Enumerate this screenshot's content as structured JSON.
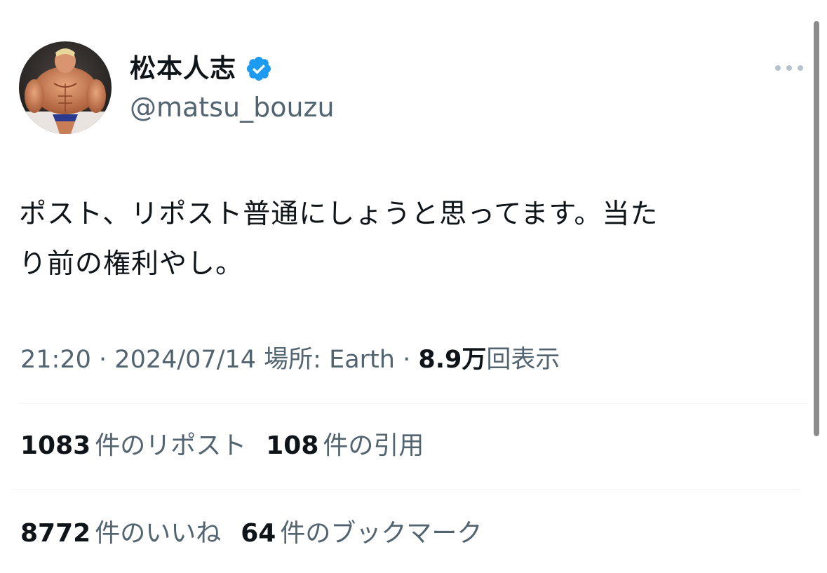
{
  "author": {
    "display_name": "松本人志",
    "handle": "@matsu_bouzu",
    "verified_badge_icon": "verified-badge-icon",
    "badge_color": "#1d9bf0"
  },
  "post": {
    "text": "ポスト、リポスト普通にしょうと思ってます。当た\nり前の権利やし。",
    "time": "21:20",
    "date": "2024/07/14",
    "location_label": "場所: Earth",
    "separator": "·",
    "views_count": "8.9万",
    "views_label": "回表示"
  },
  "stats": {
    "reposts": {
      "count": "1083",
      "label": "件のリポスト"
    },
    "quotes": {
      "count": "108",
      "label": "件の引用"
    },
    "likes": {
      "count": "8772",
      "label": "件のいいね"
    },
    "bookmarks": {
      "count": "64",
      "label": "件のブックマーク"
    }
  },
  "icons": {
    "more": "more-horizontal-icon",
    "avatar": "avatar-image"
  },
  "colors": {
    "text": "#0f1419",
    "secondary": "#536471",
    "divider": "#eff3f4",
    "accent": "#1d9bf0"
  }
}
